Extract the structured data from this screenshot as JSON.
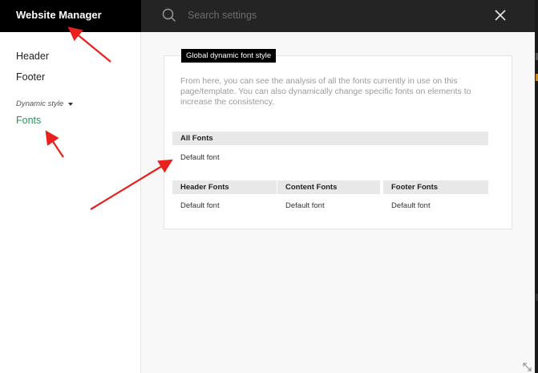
{
  "sidebar": {
    "title": "Website Manager",
    "items": [
      {
        "label": "Header"
      },
      {
        "label": "Footer"
      }
    ],
    "group_label": "Dynamic style",
    "active_item": "Fonts"
  },
  "search": {
    "placeholder": "Search settings"
  },
  "card": {
    "tag": "Global dynamic font style",
    "description": "From here, you can see the analysis of all the fonts currently in use on this page/template. You can also dynamically change specific fonts on elements to increase the consistency.",
    "all_fonts": {
      "header": "All Fonts",
      "value": "Default font"
    },
    "columns": [
      {
        "header": "Header Fonts",
        "value": "Default font"
      },
      {
        "header": "Content Fonts",
        "value": "Default font"
      },
      {
        "header": "Footer Fonts",
        "value": "Default font"
      }
    ]
  },
  "colors": {
    "accent": "#1e9c5a",
    "annotation": "#e8201e"
  },
  "icons": [
    "search-icon",
    "close-icon",
    "chevron-down-icon",
    "expand-icon"
  ]
}
